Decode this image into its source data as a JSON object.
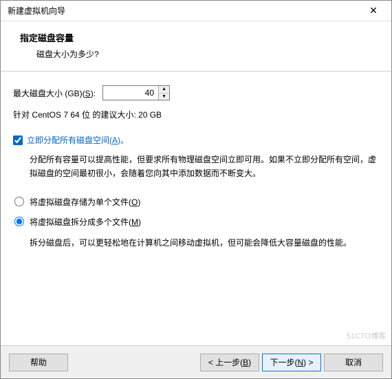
{
  "window": {
    "title": "新建虚拟机向导",
    "close_glyph": "✕"
  },
  "header": {
    "title": "指定磁盘容量",
    "subtitle": "磁盘大小为多少?"
  },
  "disk_size": {
    "label_prefix": "最大磁盘大小 (GB)(",
    "label_key": "S",
    "label_suffix": "):",
    "value": "40",
    "up_glyph": "▲",
    "down_glyph": "▼"
  },
  "recommendation": "针对 CentOS 7 64 位 的建议大小: 20 GB",
  "allocate_now": {
    "checked": true,
    "label_prefix": "立即分配所有磁盘空间(",
    "label_key": "A",
    "label_suffix": ")。",
    "description": "分配所有容量可以提高性能，但要求所有物理磁盘空间立即可用。如果不立即分配所有空间，虚拟磁盘的空间最初很小，会随着您向其中添加数据而不断变大。"
  },
  "storage_mode": {
    "selected": "split",
    "single": {
      "label_prefix": "将虚拟磁盘存储为单个文件(",
      "label_key": "O",
      "label_suffix": ")"
    },
    "split": {
      "label_prefix": "将虚拟磁盘拆分成多个文件(",
      "label_key": "M",
      "label_suffix": ")",
      "description": "拆分磁盘后，可以更轻松地在计算机之间移动虚拟机，但可能会降低大容量磁盘的性能。"
    }
  },
  "footer": {
    "help": "帮助",
    "back_prefix": "< 上一步(",
    "back_key": "B",
    "back_suffix": ")",
    "next_prefix": "下一步(",
    "next_key": "N",
    "next_suffix": ") >",
    "cancel": "取消"
  },
  "watermark": "51CTO博客"
}
